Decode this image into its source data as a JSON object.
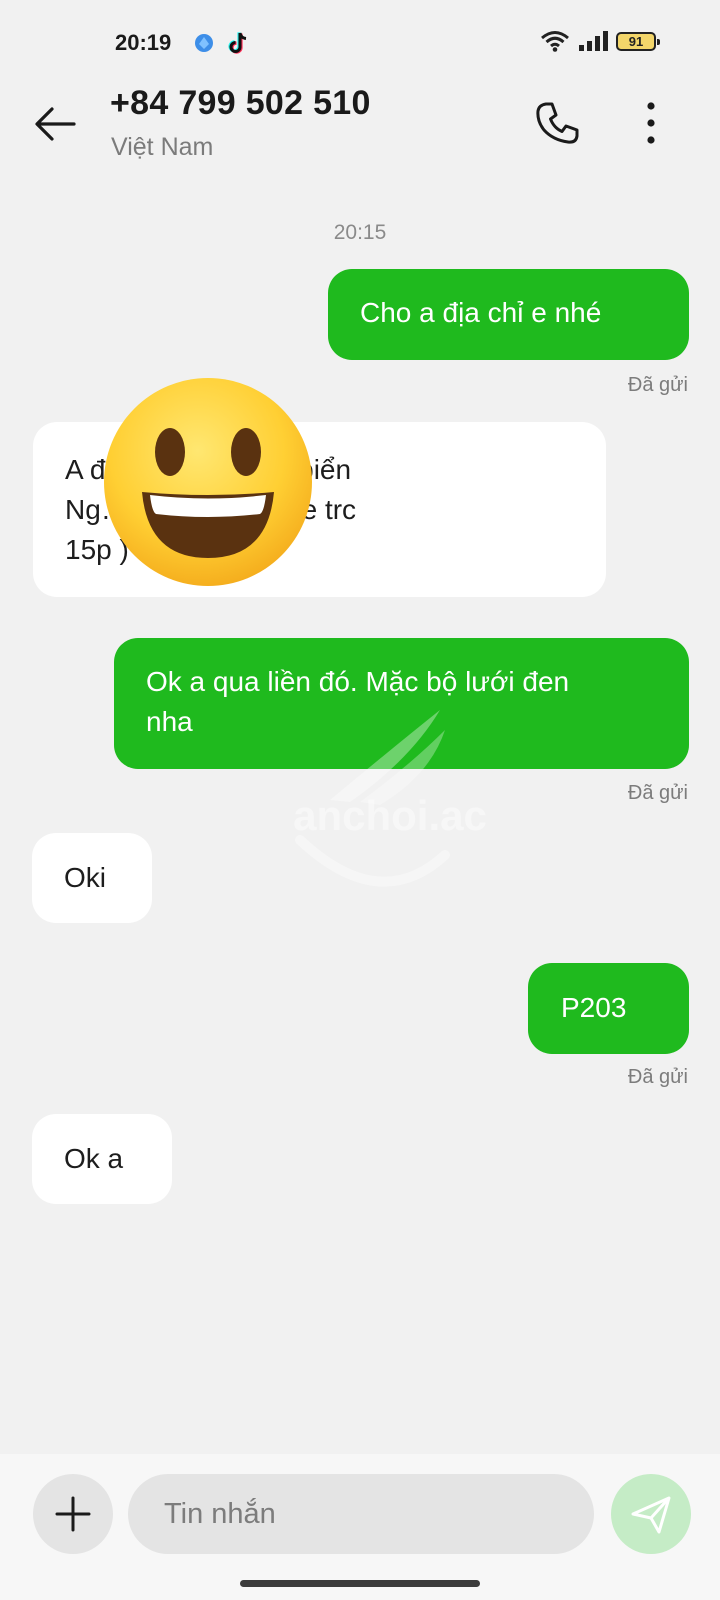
{
  "status_bar": {
    "time": "20:19",
    "battery": "91",
    "icons": [
      "blue-app-icon",
      "tiktok-icon",
      "wifi-icon",
      "signal-icon",
      "battery-icon"
    ]
  },
  "header": {
    "contact_number": "+84 799 502 510",
    "contact_country": "Việt Nam",
    "icons": [
      "back-arrow-icon",
      "phone-icon",
      "more-vertical-icon"
    ]
  },
  "chat": {
    "timestamp": "20:15",
    "messages": [
      {
        "direction": "out",
        "text": "Cho a địa chỉ e nhé",
        "status": "Đã gửi"
      },
      {
        "direction": "in",
        "lines": [
          "A đ… Sơn Trà. Ks biển",
          "Ng… a ( đến nhắn e  trc",
          "15p )"
        ]
      },
      {
        "direction": "out",
        "lines": [
          "Ok a qua liền đó. Mặc bộ lưới đen",
          "nha"
        ],
        "status": "Đã gửi"
      },
      {
        "direction": "in",
        "text": "Oki"
      },
      {
        "direction": "out",
        "text": "P203",
        "status": "Đã gửi"
      },
      {
        "direction": "in",
        "text": "Ok a"
      }
    ],
    "overlay": "grinning-face-emoji",
    "watermark": "anchoi.ac"
  },
  "composer": {
    "placeholder": "Tin nhắn",
    "icons": [
      "plus-icon",
      "send-icon"
    ]
  },
  "colors": {
    "outgoing_bubble": "#1fba1e",
    "incoming_bubble": "#ffffff",
    "background": "#f1f1f1",
    "send_button": "#c5ecc6"
  }
}
